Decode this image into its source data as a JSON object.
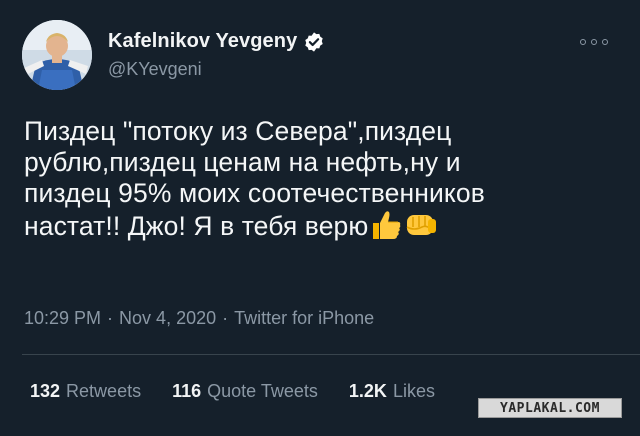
{
  "tweet": {
    "author": {
      "display_name": "Kafelnikov Yevgeny",
      "handle": "@KYevgeni",
      "verified_icon": "verified-badge-icon"
    },
    "more_icon": "more-options-icon",
    "text_lines": [
      "Пиздец \"потоку из Севера\",пиздец",
      "рублю,пиздец ценам на нефть,ну и",
      "пиздец 95% моих соотечественников",
      "настат!! Джо! Я в тебя верю"
    ],
    "emojis": [
      "thumbs-up-emoji",
      "fist-emoji"
    ],
    "time": "10:29 PM",
    "date": "Nov 4, 2020",
    "source": "Twitter for iPhone",
    "separator": "·",
    "stats": {
      "retweets_count": "132",
      "retweets_label": "Retweets",
      "quotes_count": "116",
      "quotes_label": "Quote Tweets",
      "likes_count": "1.2K",
      "likes_label": "Likes"
    }
  },
  "watermark": "YAPLAKAL.COM",
  "colors": {
    "background": "#15202b",
    "text": "#e7e9ea",
    "secondary": "#8b98a5",
    "verified": "#ffffff",
    "divider": "#38444d"
  }
}
